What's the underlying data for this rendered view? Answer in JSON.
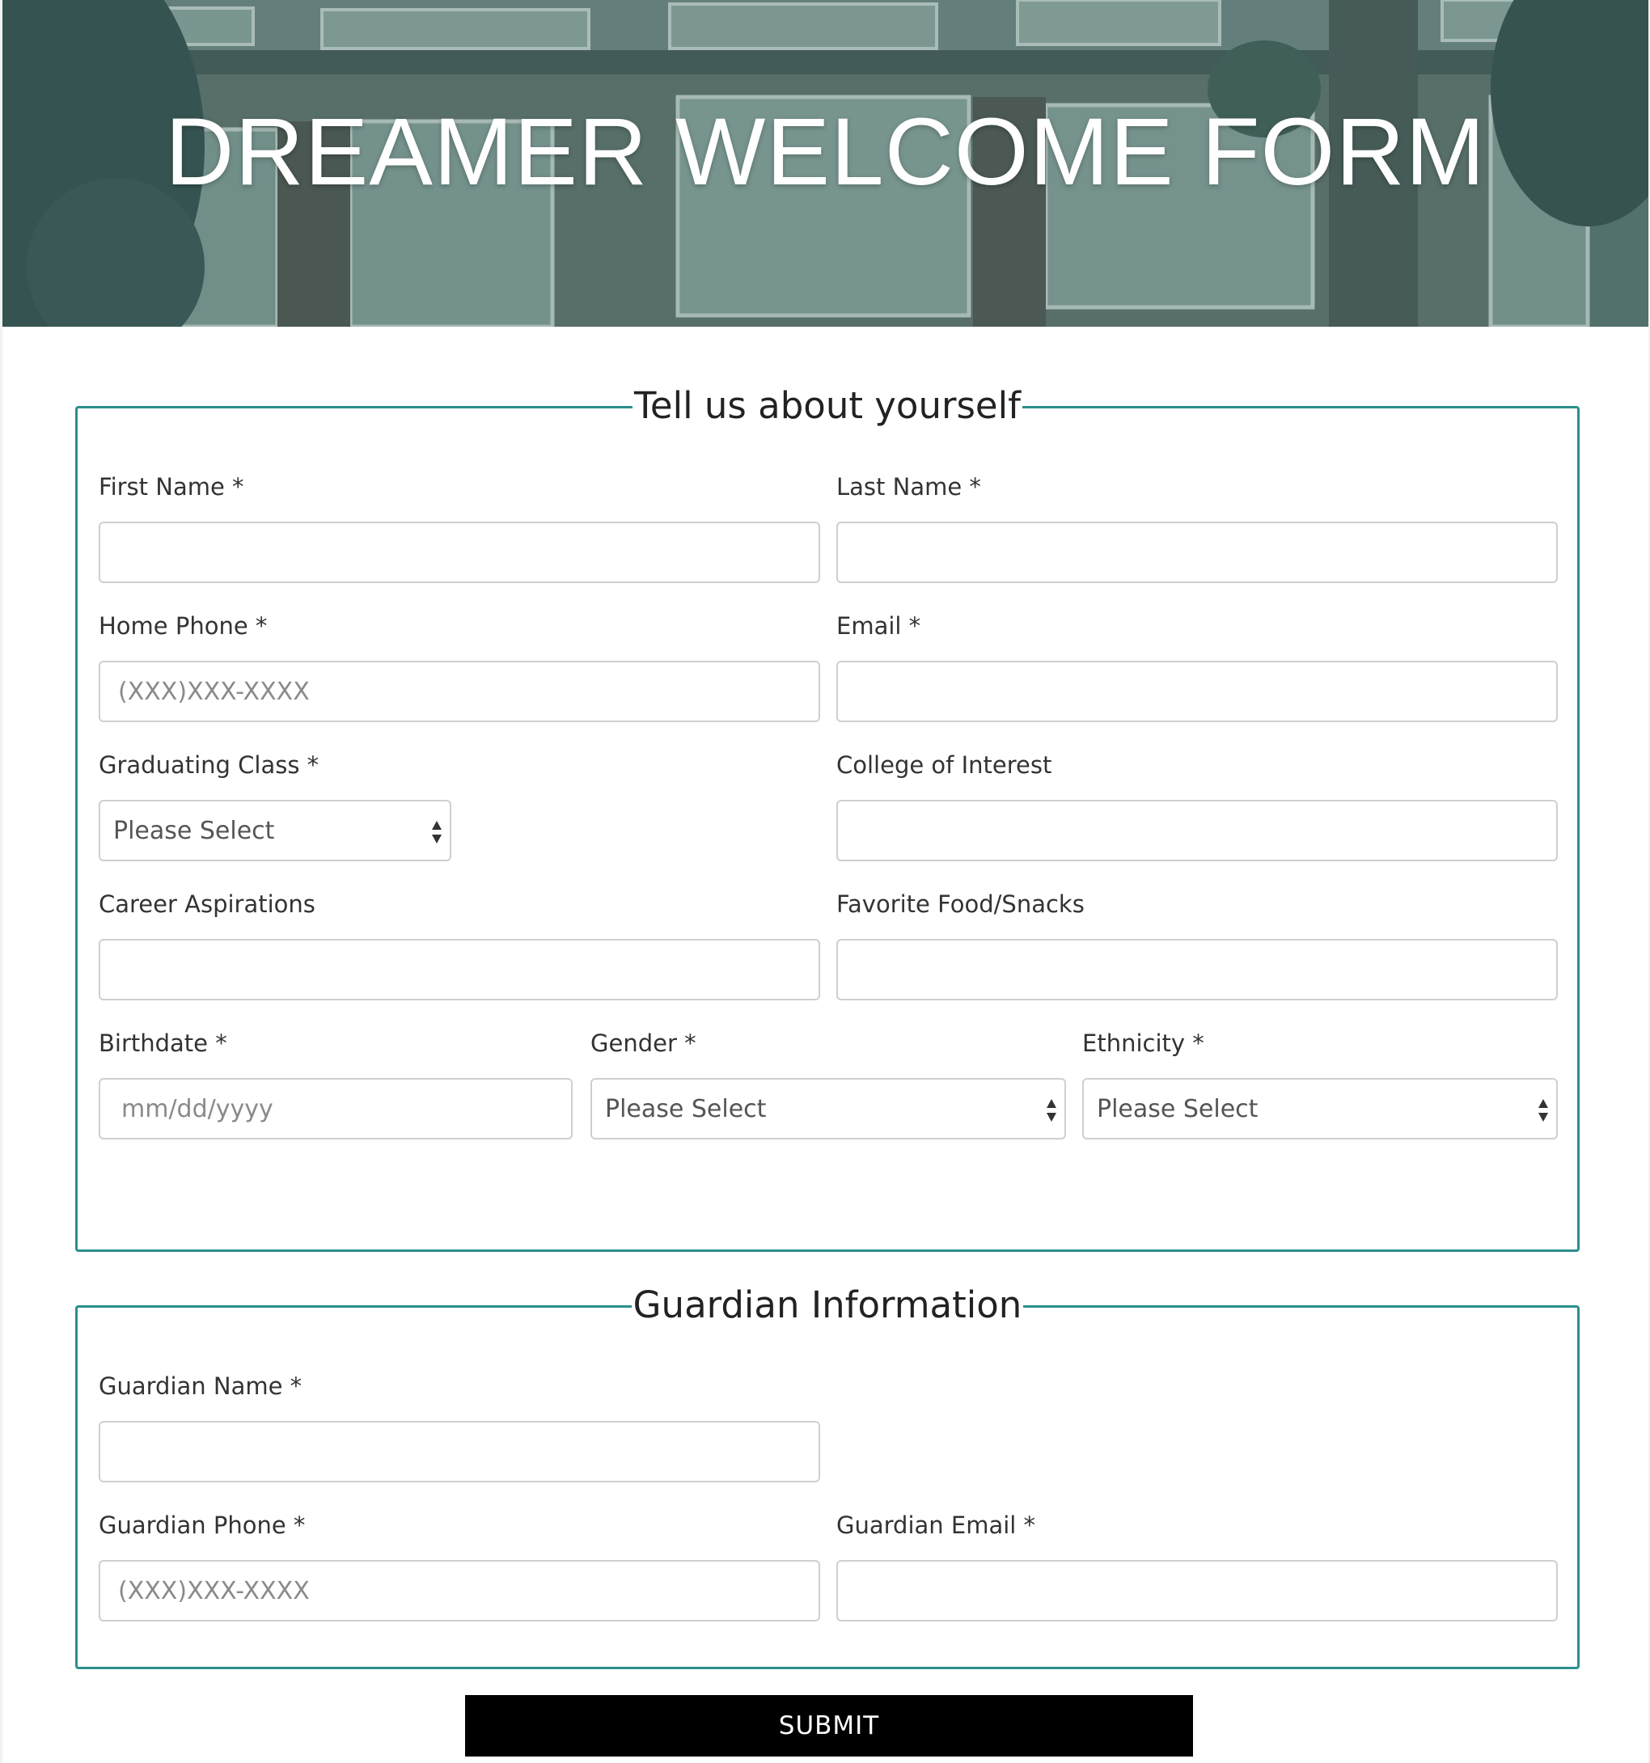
{
  "header": {
    "title": "DREAMER WELCOME FORM"
  },
  "about": {
    "legend": "Tell us about yourself",
    "first_name": {
      "label": "First Name *",
      "value": "",
      "placeholder": ""
    },
    "last_name": {
      "label": "Last Name *",
      "value": "",
      "placeholder": ""
    },
    "home_phone": {
      "label": "Home Phone *",
      "value": "",
      "placeholder": "(XXX)XXX-XXXX"
    },
    "email": {
      "label": "Email *",
      "value": "",
      "placeholder": ""
    },
    "graduating_class": {
      "label": "Graduating Class *",
      "selected": "Please Select"
    },
    "college_of_interest": {
      "label": "College of Interest",
      "value": "",
      "placeholder": ""
    },
    "career_aspirations": {
      "label": "Career Aspirations",
      "value": "",
      "placeholder": ""
    },
    "favorite_food": {
      "label": "Favorite Food/Snacks",
      "value": "",
      "placeholder": ""
    },
    "birthdate": {
      "label": "Birthdate *",
      "value": "",
      "placeholder": "mm/dd/yyyy"
    },
    "gender": {
      "label": "Gender *",
      "selected": "Please Select"
    },
    "ethnicity": {
      "label": "Ethnicity *",
      "selected": "Please Select"
    }
  },
  "guardian": {
    "legend": "Guardian Information",
    "name": {
      "label": "Guardian Name *",
      "value": "",
      "placeholder": ""
    },
    "phone": {
      "label": "Guardian Phone *",
      "value": "",
      "placeholder": "(XXX)XXX-XXXX"
    },
    "email": {
      "label": "Guardian Email *",
      "value": "",
      "placeholder": ""
    }
  },
  "submit_label": "SUBMIT",
  "colors": {
    "accent": "#2b8f8c",
    "button": "#000000",
    "banner_overlay": "#5c7876"
  },
  "icons": {
    "select_arrows": "up-down-arrows-icon"
  }
}
